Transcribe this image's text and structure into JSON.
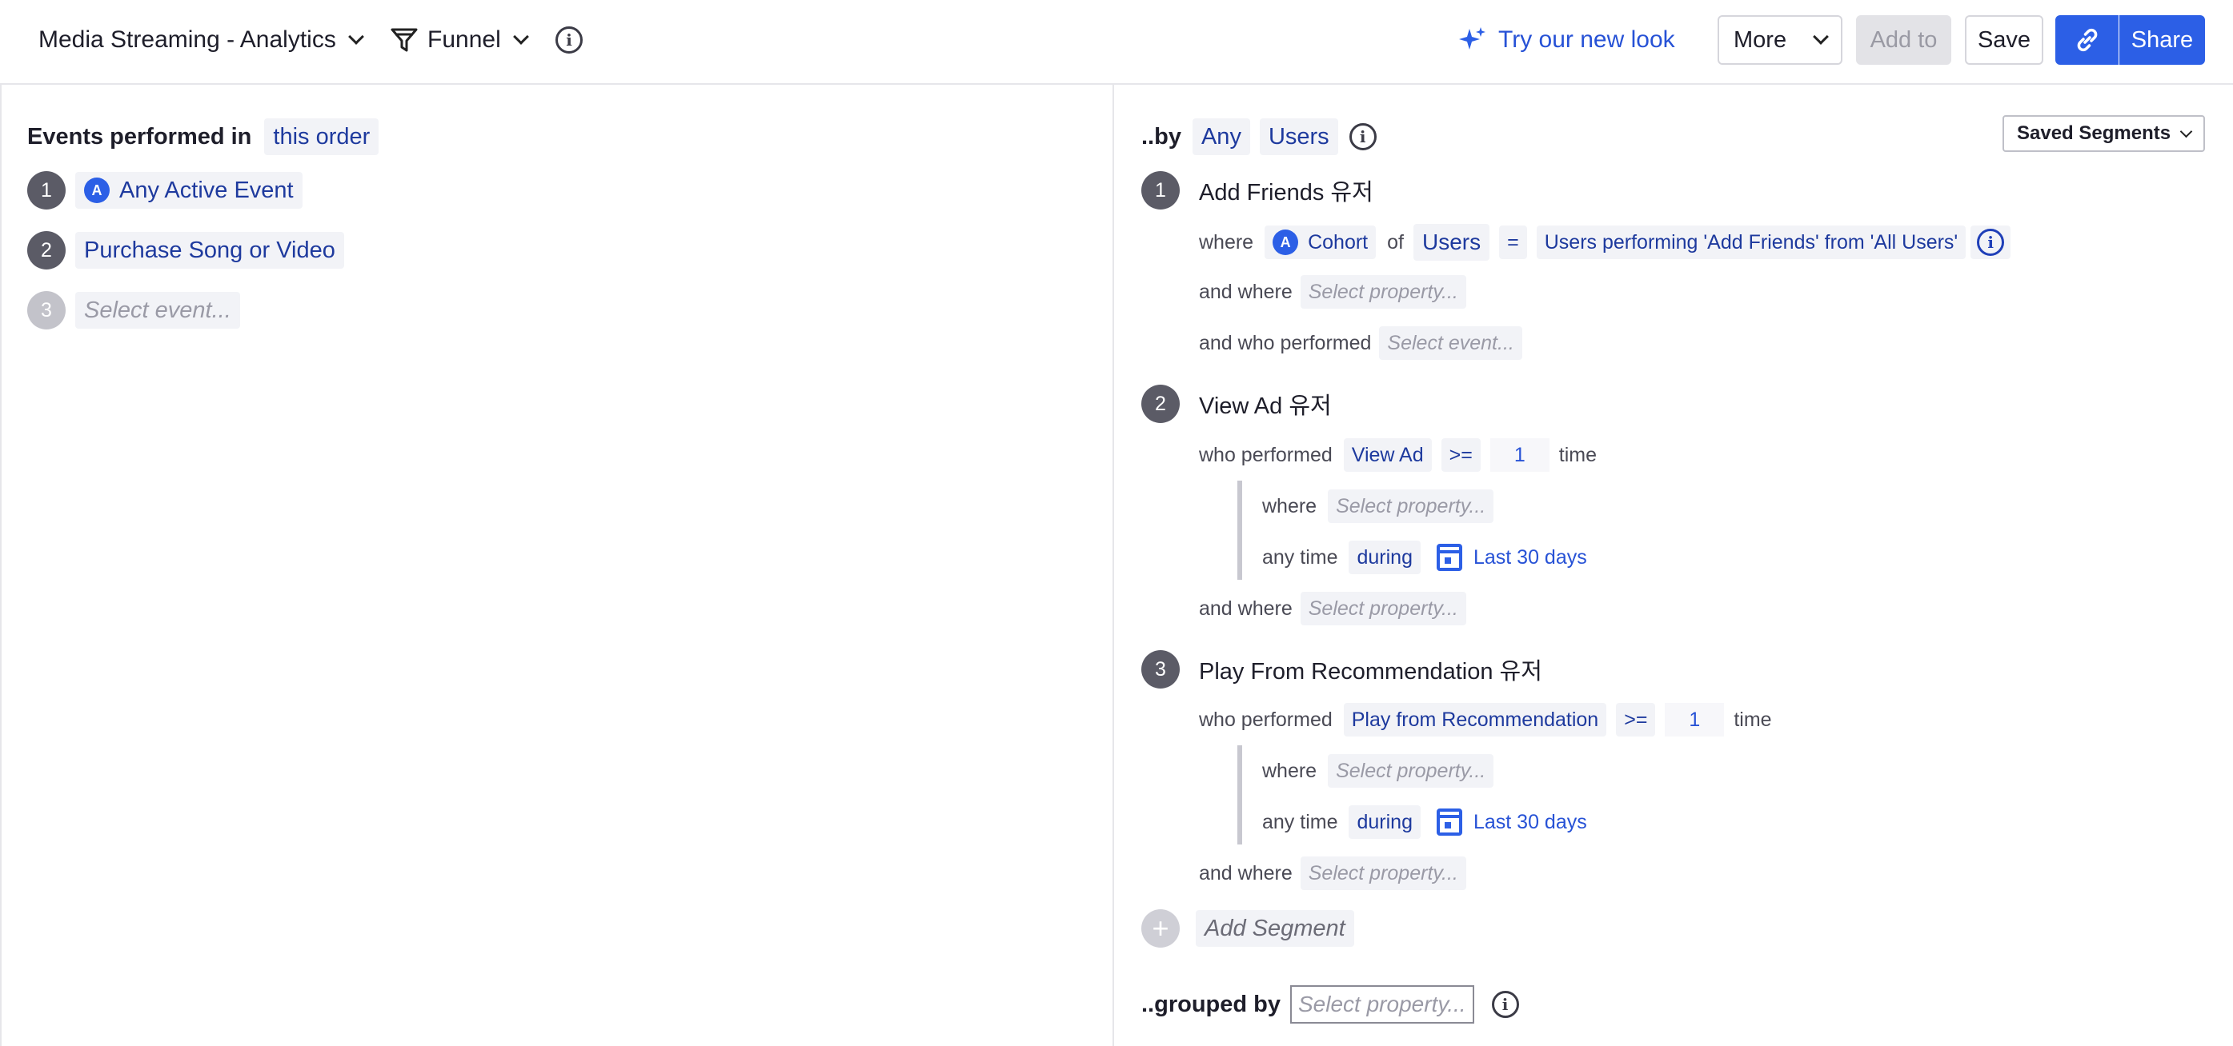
{
  "topbar": {
    "project": "Media Streaming - Analytics",
    "chart_type": "Funnel",
    "new_look": "Try our new look",
    "more": "More",
    "add_to": "Add to",
    "save": "Save",
    "share": "Share"
  },
  "left": {
    "heading": "Events performed in",
    "order": "this order",
    "events": [
      {
        "num": "1",
        "label": "Any Active Event"
      },
      {
        "num": "2",
        "label": "Purchase Song or Video"
      },
      {
        "num": "3",
        "label": "Select event..."
      }
    ]
  },
  "right": {
    "by": "..by",
    "any": "Any",
    "users": "Users",
    "saved_segments": "Saved Segments",
    "segments": [
      {
        "num": "1",
        "title": "Add Friends 유저",
        "where": "where",
        "cohort": "Cohort",
        "of": "of",
        "users": "Users",
        "eq": "=",
        "cohort_value": "Users performing 'Add Friends' from 'All Users'",
        "and_where": "and where",
        "select_property": "Select property...",
        "and_who_performed": "and who performed",
        "select_event": "Select event..."
      },
      {
        "num": "2",
        "title": "View Ad 유저",
        "who_performed": "who performed",
        "event": "View Ad",
        "op": ">=",
        "count": "1",
        "time": "time",
        "where": "where",
        "select_property": "Select property...",
        "any_time": "any time",
        "during": "during",
        "range": "Last 30 days",
        "and_where": "and where",
        "select_property2": "Select property..."
      },
      {
        "num": "3",
        "title": "Play From Recommendation 유저",
        "who_performed": "who performed",
        "event": "Play from Recommendation",
        "op": ">=",
        "count": "1",
        "time": "time",
        "where": "where",
        "select_property": "Select property...",
        "any_time": "any time",
        "during": "during",
        "range": "Last 30 days",
        "and_where": "and where",
        "select_property2": "Select property..."
      }
    ],
    "add_segment": "Add Segment",
    "grouped_by": "..grouped by",
    "grouped_placeholder": "Select property..."
  },
  "colors": {
    "accent": "#2c5fe6",
    "chip_text": "#1e3a9e",
    "chip_bg": "#f2f3f7",
    "step_badge": "#5b5b66"
  },
  "icons": [
    "chevron-down-icon",
    "funnel-icon",
    "info-icon",
    "sparkle-icon",
    "link-icon",
    "cohort-icon",
    "calendar-icon",
    "plus-icon"
  ]
}
